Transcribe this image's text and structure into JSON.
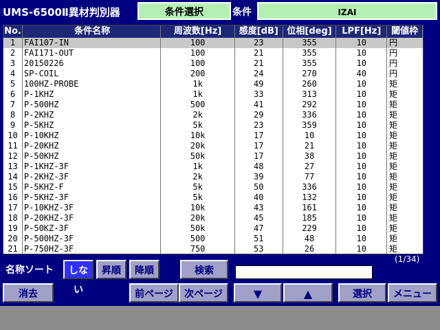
{
  "header": {
    "app_title": "UMS-6500Ⅱ異材判別器",
    "mode_label": "条件選択",
    "condition_label": "条件",
    "condition_value": "IZAI"
  },
  "table": {
    "columns": [
      "No.",
      "条件名称",
      "周波数[Hz]",
      "感度[dB]",
      "位相[deg]",
      "LPF[Hz]",
      "閾値枠"
    ],
    "selected_row": 1,
    "rows": [
      {
        "no": "1",
        "name": "FAI107-IN",
        "freq": "100",
        "sens": "23",
        "phase": "355",
        "lpf": "10",
        "th": "円"
      },
      {
        "no": "2",
        "name": "FAI171-OUT",
        "freq": "100",
        "sens": "21",
        "phase": "355",
        "lpf": "10",
        "th": "円"
      },
      {
        "no": "3",
        "name": "20150226",
        "freq": "100",
        "sens": "21",
        "phase": "355",
        "lpf": "10",
        "th": "円"
      },
      {
        "no": "4",
        "name": "SP-COIL",
        "freq": "200",
        "sens": "24",
        "phase": "270",
        "lpf": "40",
        "th": "円"
      },
      {
        "no": "5",
        "name": "100HZ-PROBE",
        "freq": "1k",
        "sens": "49",
        "phase": "260",
        "lpf": "10",
        "th": "矩"
      },
      {
        "no": "6",
        "name": "P-1KHZ",
        "freq": "1k",
        "sens": "33",
        "phase": "313",
        "lpf": "10",
        "th": "矩"
      },
      {
        "no": "7",
        "name": "P-500HZ",
        "freq": "500",
        "sens": "41",
        "phase": "292",
        "lpf": "10",
        "th": "矩"
      },
      {
        "no": "8",
        "name": "P-2KHZ",
        "freq": "2k",
        "sens": "29",
        "phase": "336",
        "lpf": "10",
        "th": "矩"
      },
      {
        "no": "9",
        "name": "P-5KHZ",
        "freq": "5k",
        "sens": "23",
        "phase": "359",
        "lpf": "10",
        "th": "矩"
      },
      {
        "no": "10",
        "name": "P-10KHZ",
        "freq": "10k",
        "sens": "17",
        "phase": "10",
        "lpf": "10",
        "th": "矩"
      },
      {
        "no": "11",
        "name": "P-20KHZ",
        "freq": "20k",
        "sens": "17",
        "phase": "21",
        "lpf": "10",
        "th": "矩"
      },
      {
        "no": "12",
        "name": "P-50KHZ",
        "freq": "50k",
        "sens": "17",
        "phase": "38",
        "lpf": "10",
        "th": "矩"
      },
      {
        "no": "13",
        "name": "P-1KHZ-3F",
        "freq": "1k",
        "sens": "48",
        "phase": "27",
        "lpf": "10",
        "th": "矩"
      },
      {
        "no": "14",
        "name": "P-2KHZ-3F",
        "freq": "2k",
        "sens": "39",
        "phase": "77",
        "lpf": "10",
        "th": "矩"
      },
      {
        "no": "15",
        "name": "P-5KHZ-F",
        "freq": "5k",
        "sens": "50",
        "phase": "336",
        "lpf": "10",
        "th": "矩"
      },
      {
        "no": "16",
        "name": "P-5KHZ-3F",
        "freq": "5k",
        "sens": "40",
        "phase": "132",
        "lpf": "10",
        "th": "矩"
      },
      {
        "no": "17",
        "name": "P-10KHZ-3F",
        "freq": "10k",
        "sens": "43",
        "phase": "161",
        "lpf": "10",
        "th": "矩"
      },
      {
        "no": "18",
        "name": "P-20KHZ-3F",
        "freq": "20k",
        "sens": "45",
        "phase": "185",
        "lpf": "10",
        "th": "矩"
      },
      {
        "no": "19",
        "name": "P-50KZ-3F",
        "freq": "50k",
        "sens": "47",
        "phase": "229",
        "lpf": "10",
        "th": "矩"
      },
      {
        "no": "20",
        "name": "P-500HZ-3F",
        "freq": "500",
        "sens": "51",
        "phase": "48",
        "lpf": "10",
        "th": "矩"
      },
      {
        "no": "21",
        "name": "P-750HZ-3F",
        "freq": "750",
        "sens": "53",
        "phase": "26",
        "lpf": "10",
        "th": "矩"
      }
    ]
  },
  "pager": {
    "indicator": "(1/34)"
  },
  "sort": {
    "label": "名称ソート",
    "none_label": "しない",
    "asc_label": "昇順",
    "desc_label": "降順",
    "active": "none"
  },
  "search": {
    "button_label": "検索",
    "value": ""
  },
  "toolbar": {
    "delete_label": "消去",
    "prev_page_label": "前ページ",
    "next_page_label": "次ページ",
    "down_label": "▼",
    "up_label": "▲",
    "select_label": "選択",
    "menu_label": "メニュー"
  },
  "colors": {
    "panel_bg": "#000080",
    "highlight_green": "#b4f0b4",
    "button_bg": "#a0a0c8",
    "button_active": "#3030ff",
    "selected_row": "#c8c8c8"
  }
}
